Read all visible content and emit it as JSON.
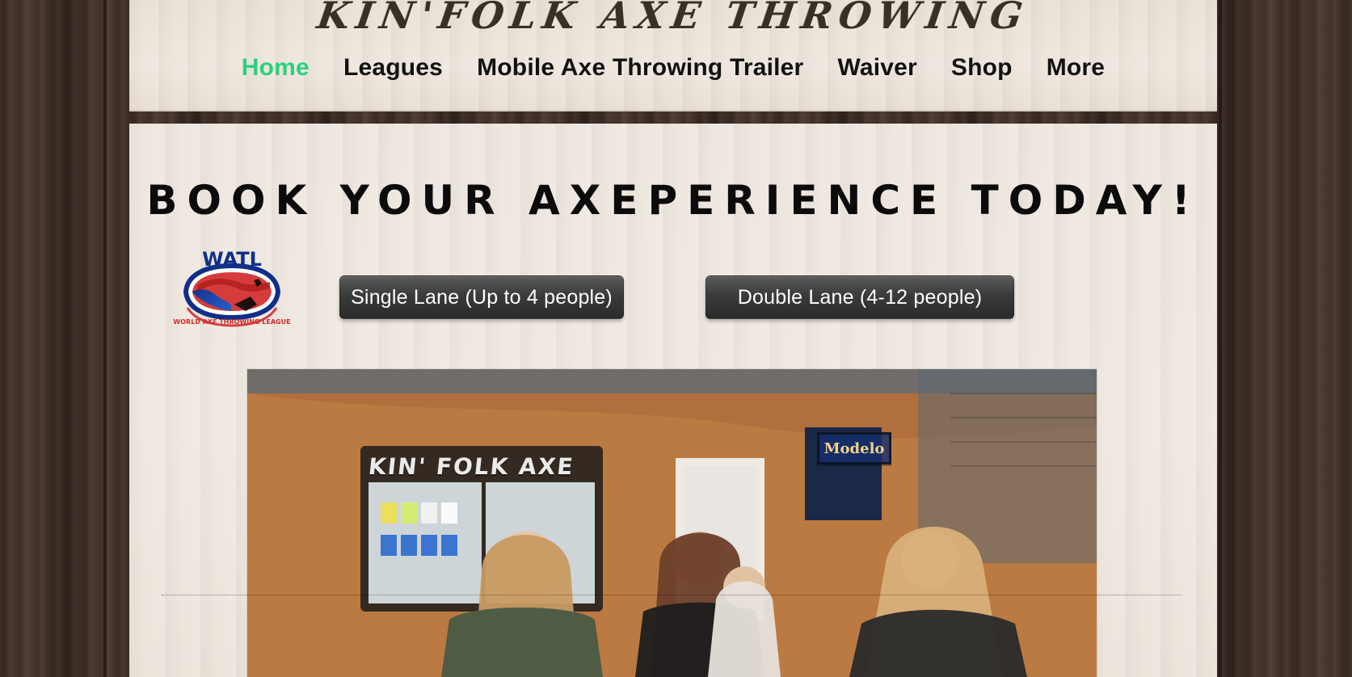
{
  "site": {
    "brand_title": "KIN'FOLK AXE THROWING"
  },
  "nav": {
    "items": [
      {
        "label": "Home",
        "active": true
      },
      {
        "label": "Leagues",
        "active": false
      },
      {
        "label": "Mobile Axe Throwing Trailer",
        "active": false
      },
      {
        "label": "Waiver",
        "active": false
      },
      {
        "label": "Shop",
        "active": false
      },
      {
        "label": "More",
        "active": false
      }
    ]
  },
  "hero": {
    "headline": "BOOK YOUR AXEPERIENCE TODAY!",
    "buttons": [
      {
        "label": "Single Lane (Up to 4 people)"
      },
      {
        "label": "Double Lane (4-12 people)"
      }
    ],
    "logo": {
      "name": "WATL",
      "text": "WORLD AXE THROWING LEAGUE"
    }
  },
  "media": {
    "photo_overlay_text": {
      "brand": "KIN' FOLK AXE",
      "modelo": "Modelo"
    }
  },
  "colors": {
    "nav_active": "#2bd17c",
    "header_bg": "#efe7de",
    "content_bg": "#f0e9e1",
    "button_dark": "#2b2b2b"
  },
  "icons": {
    "watl_logo": "watl-logo"
  }
}
